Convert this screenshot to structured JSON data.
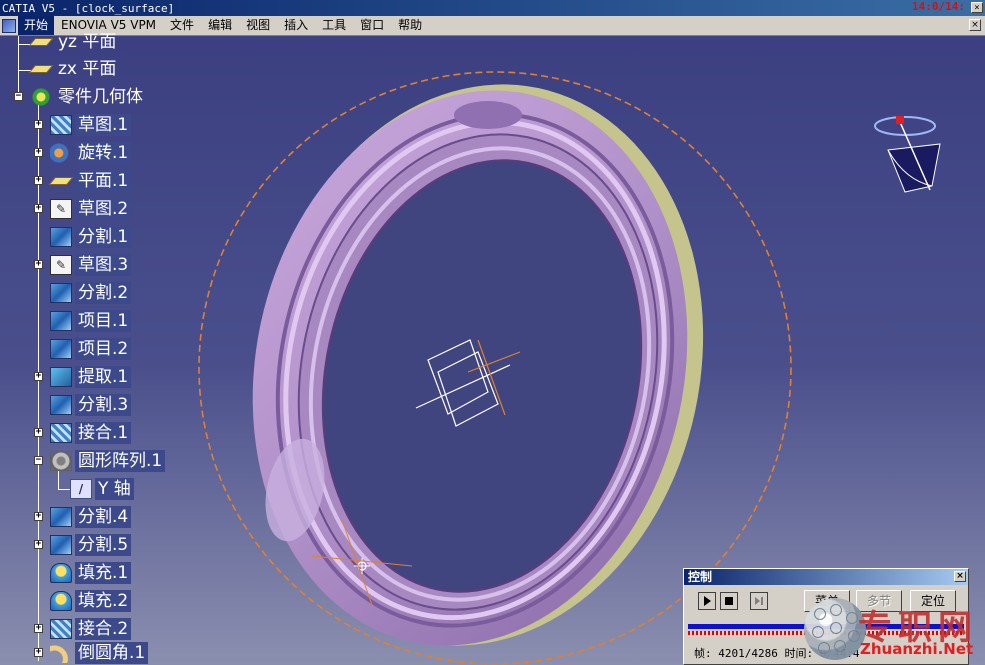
{
  "window": {
    "title": "CATIA V5 - [clock_surface]",
    "clock": "14:0/14:",
    "close_glyph": "×"
  },
  "menubar": {
    "items": [
      "开始",
      "ENOVIA V5 VPM",
      "文件",
      "编辑",
      "视图",
      "插入",
      "工具",
      "窗口",
      "帮助"
    ],
    "mdi_close_glyph": "×"
  },
  "spec_tree": {
    "items": [
      {
        "label": "yz 平面",
        "icon": "plane-icon"
      },
      {
        "label": "zx 平面",
        "icon": "plane-icon"
      },
      {
        "label": "零件几何体",
        "icon": "part-body-icon"
      },
      {
        "label": "草图.1",
        "icon": "sketch-icon"
      },
      {
        "label": "旋转.1",
        "icon": "revolve-icon"
      },
      {
        "label": "平面.1",
        "icon": "plane-icon"
      },
      {
        "label": "草图.2",
        "icon": "sketch-icon"
      },
      {
        "label": "分割.1",
        "icon": "split-icon"
      },
      {
        "label": "草图.3",
        "icon": "sketch-icon"
      },
      {
        "label": "分割.2",
        "icon": "split-icon"
      },
      {
        "label": "项目.1",
        "icon": "projection-icon"
      },
      {
        "label": "项目.2",
        "icon": "projection-icon"
      },
      {
        "label": "提取.1",
        "icon": "extract-icon"
      },
      {
        "label": "分割.3",
        "icon": "split-icon"
      },
      {
        "label": "接合.1",
        "icon": "join-icon"
      },
      {
        "label": "圆形阵列.1",
        "icon": "circular-pattern-icon"
      },
      {
        "label": "Y 轴",
        "icon": "axis-icon"
      },
      {
        "label": "分割.4",
        "icon": "split-icon"
      },
      {
        "label": "分割.5",
        "icon": "split-icon"
      },
      {
        "label": "填充.1",
        "icon": "fill-icon"
      },
      {
        "label": "填充.2",
        "icon": "fill-icon"
      },
      {
        "label": "接合.2",
        "icon": "join-icon"
      },
      {
        "label": "倒圆角.1",
        "icon": "fillet-icon"
      }
    ],
    "plus_glyph": "+",
    "minus_glyph": "−",
    "sketch_glyph": "✎",
    "axis_glyph": "/"
  },
  "control_panel": {
    "title": "控制",
    "close_glyph": "×",
    "buttons": {
      "menu": "菜单",
      "multi_step": "多节",
      "locate": "定位"
    },
    "status": "帧: 4201/4286 时间: 0/44:4"
  },
  "watermark": {
    "cn": "专职网",
    "en": "Zhuanzhi.Net"
  },
  "colors": {
    "background_top": "#3a3e80",
    "ring": "#b090c8",
    "ring_dark": "#7a5c9c",
    "ring_edge": "#c8c890",
    "dash_circle": "#e08030",
    "compass": "#1a1a60"
  }
}
